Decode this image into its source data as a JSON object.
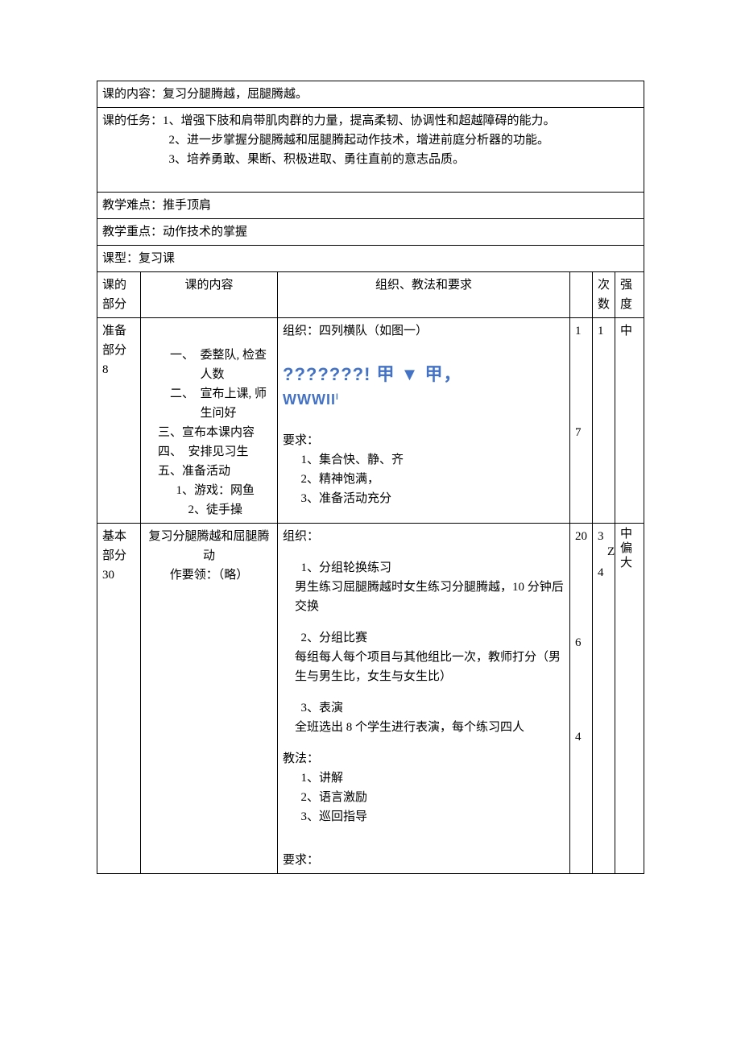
{
  "header": {
    "content_label": "课的内容：",
    "content_text": "复习分腿腾越，屈腿腾越。",
    "task_label": "课的任务：",
    "task1": "1、增强下肢和肩带肌肉群的力量，提高柔韧、协调性和超越障碍的能力。",
    "task2": "2、进一步掌握分腿腾越和屈腿腾起动作技术，增进前庭分析器的功能。",
    "task3": "3、培养勇敢、果断、积极进取、勇往直前的意志品质。",
    "difficulty_label": "教学难点：",
    "difficulty_text": "推手顶肩",
    "focus_label": "教学重点：",
    "focus_text": "动作技术的掌握",
    "type_label": "课型：",
    "type_text": "复习课"
  },
  "columns": {
    "part": "课的部分",
    "content": "课的内容",
    "organization": "组织、教法和要求",
    "times": "次数",
    "intensity": "强度"
  },
  "prep": {
    "part_label": "准备部分 8",
    "c1": "一、　委整队, 检查人数",
    "c2": "二、　宣布上课, 师生问好",
    "c3": "三、宣布本课内容",
    "c4": "四、　安排见习生",
    "c5": "五、准备活动",
    "c5a": "1、游戏：网鱼",
    "c5b": "2、徒手操",
    "org_title": "组织：四列横队（如图一）",
    "formation1": "???????! 甲 ▼ 甲，",
    "formation2": "WWWII",
    "req_title": "要求：",
    "req1": "1、集合快、静、齐",
    "req2": "2、精神饱满，",
    "req3": "3、准备活动充分",
    "num_a1": "1",
    "num_a2": "7",
    "num_b": "1",
    "intensity": "中"
  },
  "basic": {
    "part_label": "基本部分 30",
    "content_line1": "复习分腿腾越和屈腿腾动",
    "content_line2": "作要领：（略）",
    "org_label": "组织：",
    "o1_title": "1、分组轮换练习",
    "o1_body": "男生练习屈腿腾越时女生练习分腿腾越，10 分钟后交换",
    "o2_title": "2、分组比赛",
    "o2_body": "每组每人每个项目与其他组比一次，教师打分（男生与男生比，女生与女生比）",
    "o3_title": "3、表演",
    "o3_body": "全班选出 8 个学生进行表演，每个练习四人",
    "method_label": "教法：",
    "m1": "1、讲解",
    "m2": "2、语言激励",
    "m3": "3、巡回指导",
    "req_label_end": "要求：",
    "num_a1": "20",
    "num_a2": "6",
    "num_a3": "4",
    "num_b1": "3",
    "num_b1sub": "Z",
    "num_b2": "4",
    "intensity": "中偏大"
  }
}
